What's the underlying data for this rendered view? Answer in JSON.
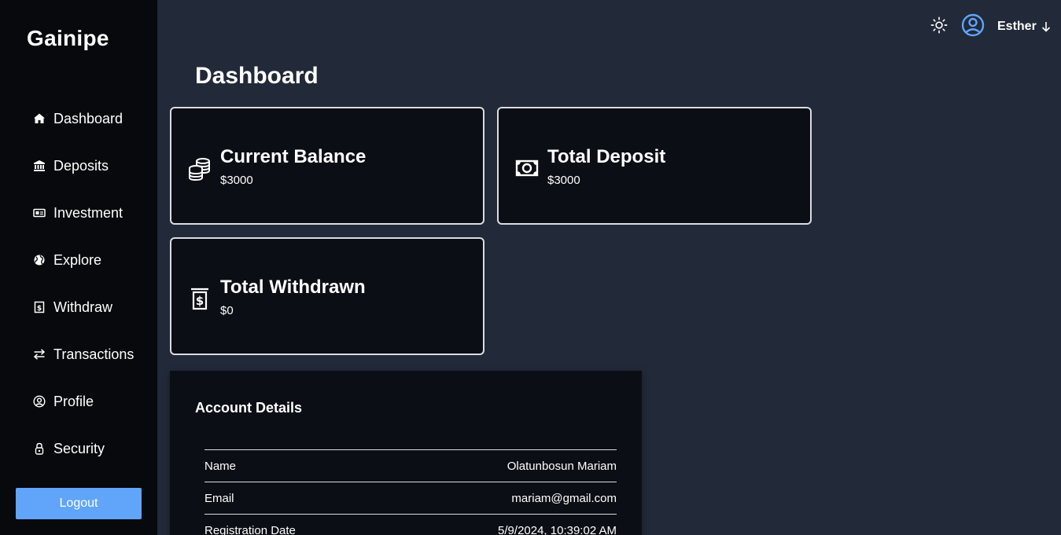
{
  "brand": "Gainipe",
  "sidebar": {
    "items": [
      {
        "label": "Dashboard",
        "icon": "home-icon"
      },
      {
        "label": "Deposits",
        "icon": "bank-icon"
      },
      {
        "label": "Investment",
        "icon": "ticket-icon"
      },
      {
        "label": "Explore",
        "icon": "globe-icon"
      },
      {
        "label": "Withdraw",
        "icon": "receipt-dollar-icon"
      },
      {
        "label": "Transactions",
        "icon": "arrows-exchange-icon"
      },
      {
        "label": "Profile",
        "icon": "user-circle-icon"
      },
      {
        "label": "Security",
        "icon": "lock-icon"
      }
    ],
    "logout_label": "Logout"
  },
  "header": {
    "theme_icon": "sun-icon",
    "avatar_icon": "user-circle-icon",
    "avatar_color": "#60a5fa",
    "user_name": "Esther",
    "menu_icon": "arrow-down-icon"
  },
  "page_title": "Dashboard",
  "cards": [
    {
      "title": "Current Balance",
      "value": "$3000",
      "icon": "coins-icon"
    },
    {
      "title": "Total Deposit",
      "value": "$3000",
      "icon": "cash-icon"
    },
    {
      "title": "Total Withdrawn",
      "value": "$0",
      "icon": "receipt-dollar-icon"
    }
  ],
  "account_details": {
    "title": "Account Details",
    "rows": [
      {
        "label": "Name",
        "value": "Olatunbosun Mariam"
      },
      {
        "label": "Email",
        "value": "mariam@gmail.com"
      },
      {
        "label": "Registration Date",
        "value": "5/9/2024, 10:39:02 AM"
      }
    ]
  },
  "colors": {
    "accent": "#60a5fa",
    "sidebar_bg": "#07090d",
    "main_bg": "#222938",
    "card_bg": "#0b0e14"
  }
}
